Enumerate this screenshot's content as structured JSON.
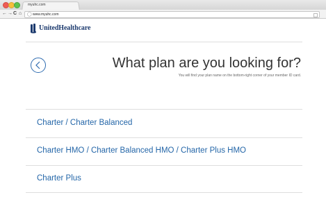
{
  "browser": {
    "tab_title": "myuhc.com",
    "url": "www.myuhc.com",
    "nav": {
      "back": "←",
      "forward": "→",
      "reload": "C",
      "home": "⌂"
    }
  },
  "brand": {
    "name": "UnitedHealthcare",
    "color": "#1c3a6e"
  },
  "main": {
    "heading": "What plan are you looking for?",
    "subtext": "You will find your plan name on the bottom-right corner of your member ID card.",
    "back_icon": "chevron-left-icon",
    "options": [
      "Charter / Charter Balanced",
      "Charter HMO / Charter Balanced HMO / Charter Plus HMO",
      "Charter Plus"
    ]
  },
  "colors": {
    "link": "#2466a8",
    "divider": "#dedede",
    "heading": "#333333"
  }
}
